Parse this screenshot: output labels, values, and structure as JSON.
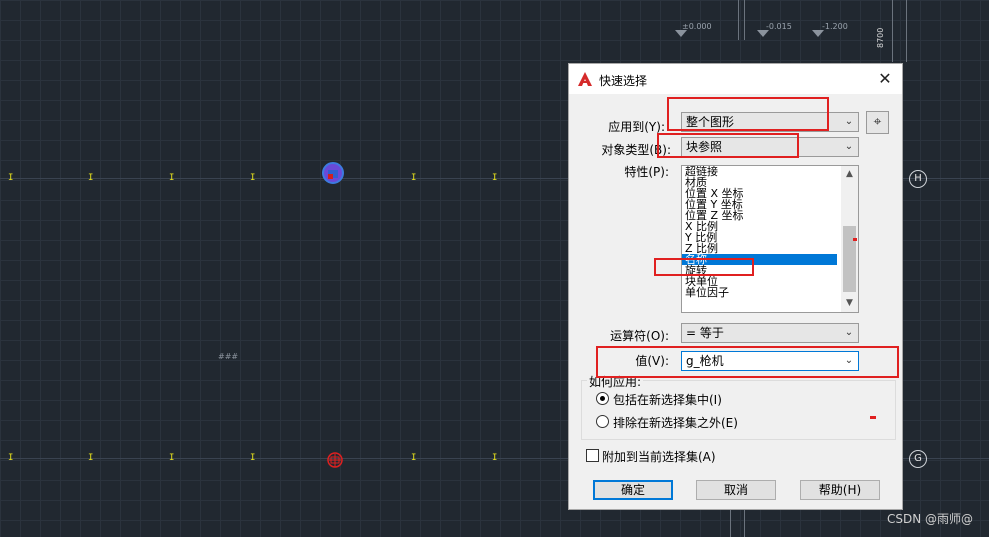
{
  "drawing": {
    "elevations": [
      "±0.000",
      "-0.015",
      "-1.200"
    ],
    "dimension": "8700",
    "grid_bubbles": [
      "H",
      "G"
    ],
    "annotation": "###"
  },
  "dialog": {
    "title": "快速选择",
    "close_label": "✕",
    "apply_to": {
      "label": "应用到(Y):",
      "value": "整个图形"
    },
    "object_type": {
      "label": "对象类型(B):",
      "value": "块参照"
    },
    "properties": {
      "label": "特性(P):",
      "items": [
        "超链接",
        "材质",
        "位置 X 坐标",
        "位置 Y 坐标",
        "位置 Z 坐标",
        "X 比例",
        "Y 比例",
        "Z 比例",
        "名称",
        "旋转",
        "块单位",
        "单位因子"
      ],
      "selected": "名称"
    },
    "operator": {
      "label": "运算符(O):",
      "value": "= 等于"
    },
    "value": {
      "label": "值(V):",
      "value": "g_枪机"
    },
    "how_to_apply": {
      "title": "如何应用:",
      "include": "包括在新选择集中(I)",
      "exclude": "排除在新选择集之外(E)",
      "selected": "include"
    },
    "append_checkbox": {
      "label": "附加到当前选择集(A)",
      "checked": false
    },
    "buttons": {
      "ok": "确定",
      "cancel": "取消",
      "help": "帮助(H)"
    }
  },
  "watermark": "CSDN @雨师@",
  "colors": {
    "background": "#212830",
    "marker": "#e8e21c",
    "highlight": "#e02020",
    "selection": "#0078d7"
  }
}
